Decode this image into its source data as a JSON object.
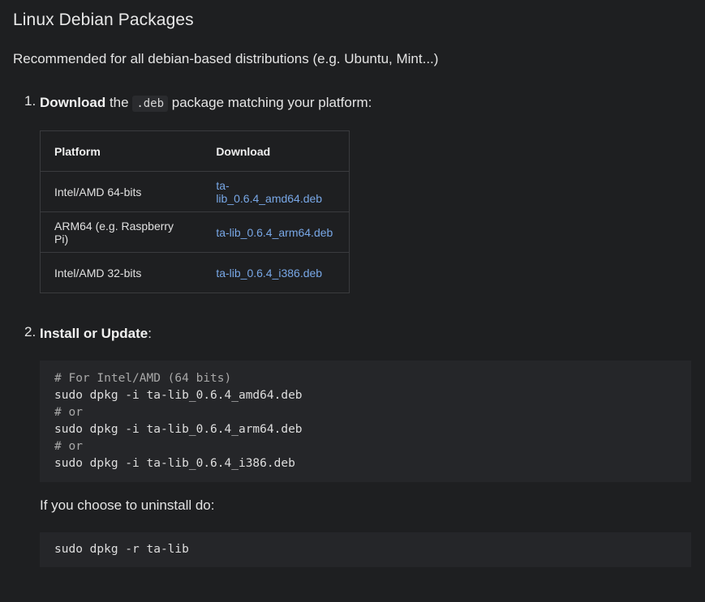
{
  "heading": "Linux Debian Packages",
  "intro": "Recommended for all debian-based distributions (e.g. Ubuntu, Mint...)",
  "step1": {
    "number": "1.",
    "bold": "Download",
    "text_before": " the ",
    "code": ".deb",
    "text_after": " package matching your platform:"
  },
  "table": {
    "headers": [
      "Platform",
      "Download"
    ],
    "rows": [
      {
        "platform": "Intel/AMD 64-bits",
        "file": "ta-lib_0.6.4_amd64.deb"
      },
      {
        "platform": "ARM64 (e.g. Raspberry Pi)",
        "file": "ta-lib_0.6.4_arm64.deb"
      },
      {
        "platform": "Intel/AMD 32-bits",
        "file": "ta-lib_0.6.4_i386.deb"
      }
    ]
  },
  "step2": {
    "number": "2.",
    "bold": "Install or Update",
    "suffix": ":"
  },
  "code_install": {
    "lines": [
      {
        "text": "# For Intel/AMD (64 bits)",
        "comment": true
      },
      {
        "text": "sudo dpkg -i ta-lib_0.6.4_amd64.deb",
        "comment": false
      },
      {
        "text": "# or",
        "comment": true
      },
      {
        "text": "sudo dpkg -i ta-lib_0.6.4_arm64.deb",
        "comment": false
      },
      {
        "text": "# or",
        "comment": true
      },
      {
        "text": "sudo dpkg -i ta-lib_0.6.4_i386.deb",
        "comment": false
      }
    ]
  },
  "uninstall_text": "If you choose to uninstall do:",
  "code_uninstall": "sudo dpkg -r ta-lib",
  "colors": {
    "background": "#1e1f21",
    "link": "#78a7e6",
    "code_bg": "#252629"
  }
}
